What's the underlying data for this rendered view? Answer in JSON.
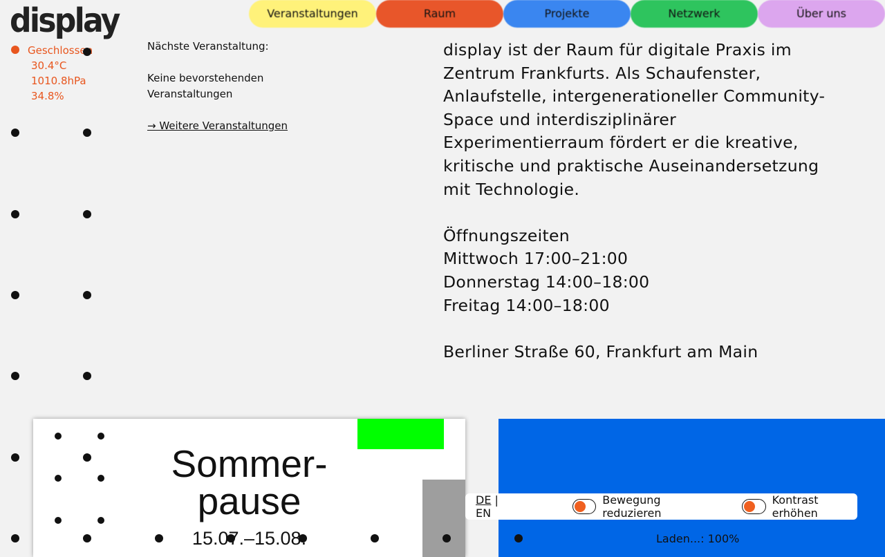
{
  "logo": "display",
  "status": {
    "state": "Geschlossen",
    "temperature": "30.4°C",
    "pressure": "1010.8hPa",
    "humidity": "34.8%",
    "color": "#e8561e"
  },
  "nav": [
    {
      "label": "Veranstaltungen",
      "color": "#fff27a"
    },
    {
      "label": "Raum",
      "color": "#e8562a"
    },
    {
      "label": "Projekte",
      "color": "#3a86f0"
    },
    {
      "label": "Netzwerk",
      "color": "#2ec45e"
    },
    {
      "label": "Über uns",
      "color": "#dca6ee"
    }
  ],
  "next_event": {
    "heading": "Nächste Veranstaltung:",
    "none": "Keine bevorstehenden Veranstaltungen",
    "more_link": "→ Weitere Veranstaltungen"
  },
  "about": {
    "text": "display ist der Raum für digitale Praxis im Zentrum Frankfurts. Als Schaufenster, Anlaufstelle, intergenerationeller Community-Space und interdisziplinärer Experimentierraum fördert er die kreative, kritische und praktische Auseinandersetzung mit Technologie.",
    "hours_title": "Öffnungszeiten",
    "hours": [
      "Mittwoch 17:00–21:00",
      "Donnerstag 14:00–18:00",
      "Freitag 14:00–18:00"
    ],
    "address": "Berliner Straße 60, Frankfurt am Main"
  },
  "poster": {
    "line1": "Sommer-",
    "line2": "pause",
    "dates": "15.07.–15.08."
  },
  "settings": {
    "lang_de": "DE",
    "lang_sep": "|",
    "lang_en": "EN",
    "reduce_motion": "Bewegung reduzieren",
    "high_contrast": "Kontrast erhöhen"
  },
  "loading": "Laden...: 100%"
}
